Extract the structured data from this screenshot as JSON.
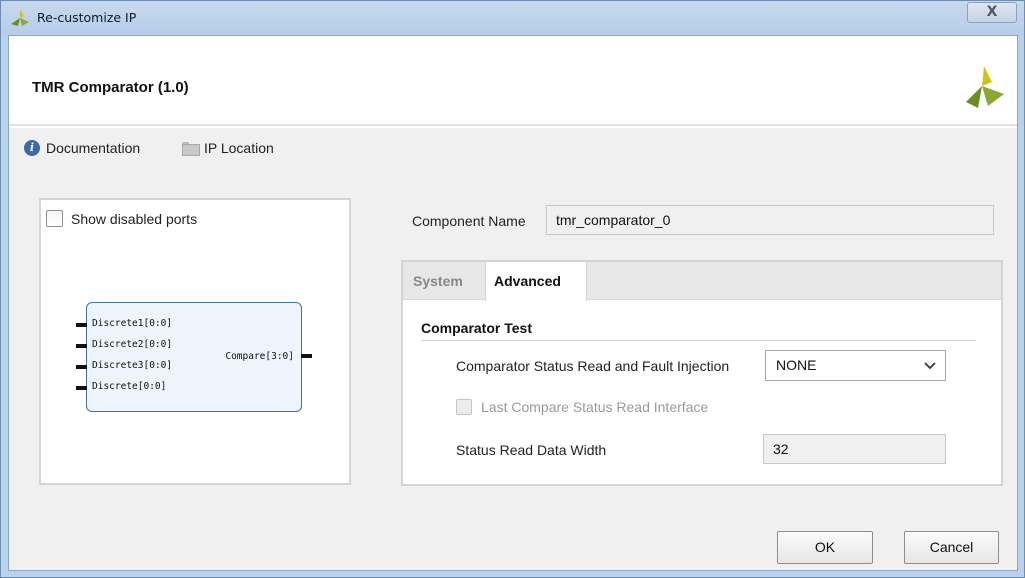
{
  "window": {
    "title": "Re-customize IP",
    "close_label": "X"
  },
  "header": {
    "ip_title": "TMR Comparator (1.0)"
  },
  "toolbar": {
    "documentation": "Documentation",
    "ip_location": "IP Location"
  },
  "preview": {
    "show_disabled_ports": "Show disabled ports",
    "inputs": [
      "Discrete1[0:0]",
      "Discrete2[0:0]",
      "Discrete3[0:0]",
      "Discrete[0:0]"
    ],
    "output": "Compare[3:0]"
  },
  "component": {
    "label": "Component Name",
    "value": "tmr_comparator_0"
  },
  "tabs": [
    {
      "label": "System",
      "active": false
    },
    {
      "label": "Advanced",
      "active": true
    }
  ],
  "advanced": {
    "group_title": "Comparator Test",
    "status_read_label": "Comparator Status Read and Fault Injection",
    "status_read_value": "NONE",
    "last_compare_label": "Last Compare Status Read Interface",
    "data_width_label": "Status Read Data Width",
    "data_width_value": "32"
  },
  "buttons": {
    "ok": "OK",
    "cancel": "Cancel"
  },
  "colors": {
    "brand_green": "#6b8e23",
    "brand_yellow": "#d4c21a",
    "title_bar": "#b9d1ea"
  }
}
